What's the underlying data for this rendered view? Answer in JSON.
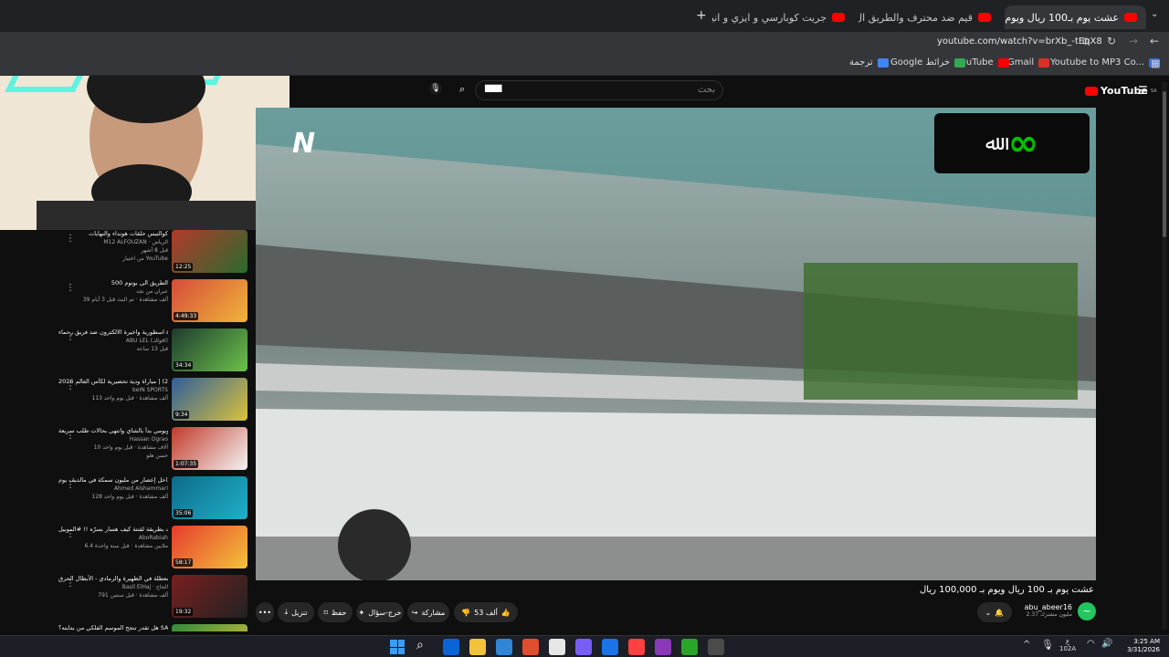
{
  "browser": {
    "tabs": [
      {
        "label": "(24) عشت يوم بـ100 ريال ويوم",
        "active": true
      },
      {
        "label": "(24) قيم ضد محترف والطريق ال",
        "active": false
      },
      {
        "label": "(24) جريت كوبارسي و ايزي و انيي",
        "active": false
      }
    ],
    "new_tab": "+",
    "url": "youtube.com/watch?v=brXb_-tEqX8",
    "bookmarks": [
      "Youtube to MP3 Co...",
      "Gmail",
      "YouTube",
      "Google خرائط",
      "ترجمة"
    ]
  },
  "youtube": {
    "logo": "YouTube",
    "logo_region": "SA",
    "search_placeholder": "بحث",
    "search_value": "▇▇▇"
  },
  "sidebar_videos": [
    {
      "title": "كوالتيس حلقات هونداء والنهايات",
      "channel": "M12 ALFOUZAN · الرياض",
      "stats": "قبل 8 أشهر",
      "extra": "من اختيار YouTube",
      "badge": "الاحتفاظ",
      "duration": "12:25",
      "colors": [
        "#b23a2a",
        "#2a6b2f"
      ]
    },
    {
      "title": "الطريق الى بوتوم 500",
      "channel": "عبران من نجد",
      "stats": "39 ألف مشاهدة · تم البث قبل 3 أيام",
      "extra": "",
      "badge": "",
      "duration": "4:49:33",
      "colors": [
        "#d54c3a",
        "#f0b43a"
      ]
    },
    {
      "title": "روكيت ليق مباراة اسطورية واخيرة الالكترون ضد فريق رحماء | CS MENA...",
      "channel": "ABU LEL (اقولك)",
      "stats": "قبل 13 ساعة",
      "extra": "",
      "badge": "",
      "duration": "34:34",
      "colors": [
        "#1e3b2f",
        "#6cc24a"
      ]
    },
    {
      "title": "ملخص مباراة المانيا وغانا (1-2) | مباراة ودية تحضيرية لكأس العالم 2026",
      "channel": "beIN SPORTS",
      "stats": "113 ألف مشاهدة · قبل يوم واحد",
      "extra": "",
      "badge": "",
      "duration": "9:34",
      "colors": [
        "#2f5f9a",
        "#d9c23a"
      ]
    },
    {
      "title": "متابعة في كندا.. ويومي بدأ بالشاي وانتهى بحالات طلب سريعة",
      "channel": "Hassan Ograo",
      "stats": "10 آلاف مشاهدة · قبل يوم واحد",
      "extra": "حسن هلو",
      "badge": "",
      "duration": "1:07:35",
      "colors": [
        "#c23a2a",
        "#f4f4f4"
      ]
    },
    {
      "title": "سبحت داخل إعصار من مليون سمكة في مالديڤ يوم",
      "channel": "Ahmed Alshammari",
      "stats": "128 ألف مشاهدة · قبل يوم واحد",
      "extra": "",
      "badge": "",
      "duration": "35:06",
      "colors": [
        "#0e6b8a",
        "#1fb0c9"
      ]
    },
    {
      "title": "تريث بطريقة لقنتة كيف هسار بسرّه !! #الموبيل",
      "channel": "AboRabiah",
      "stats": "6.4 ملايين مشاهدة · قبل سنة واحدة",
      "extra": "",
      "badge": "",
      "duration": "58:17",
      "colors": [
        "#e63b2e",
        "#f4c23a"
      ]
    },
    {
      "title": "سحروو على الدايمة المعطلة في الظهيرة والرمادي - الأبطال الحرق",
      "channel": "Basil ElHaj · الحاج",
      "stats": "791 ألف مشاهدة · قبل سنتين",
      "extra": "",
      "badge": "",
      "duration": "19:32",
      "colors": [
        "#7a1f1f",
        "#222"
      ]
    },
    {
      "title": "هل تقدر تنجح الموسم الفلكي من بدايته؟ SA",
      "channel": "Peaks · Peaks",
      "stats": "",
      "extra": "",
      "badge": "",
      "duration": "",
      "colors": [
        "#2f8a3a",
        "#d9c23a"
      ]
    }
  ],
  "video": {
    "title": "عشت يوم بـ 100 ريال ويوم بـ 100,000 ريال",
    "channel": "abu_abeer16",
    "subscribers": "2.37 مليون مشترك",
    "likes": "53 ألف",
    "actions": [
      "مشاركة",
      "خرج-سؤال",
      "حفظ",
      "تنزيل"
    ],
    "overflow": "•••",
    "watermark_left": "N",
    "logo_box_colors": [
      "#0a0a0a",
      "#00c000"
    ]
  },
  "taskbar": {
    "time": "3:25 AM",
    "date": "3/31/2026",
    "lang": "ع\n102A",
    "apps": [
      "#0a64d8",
      "#f4c23a",
      "#2f86d6",
      "#e04e2f",
      "#e6e6e6",
      "#7a5cf6",
      "#1a73e8",
      "#ff4040",
      "#8a3ab9",
      "#2aa52a",
      "#4b4b4b"
    ]
  }
}
